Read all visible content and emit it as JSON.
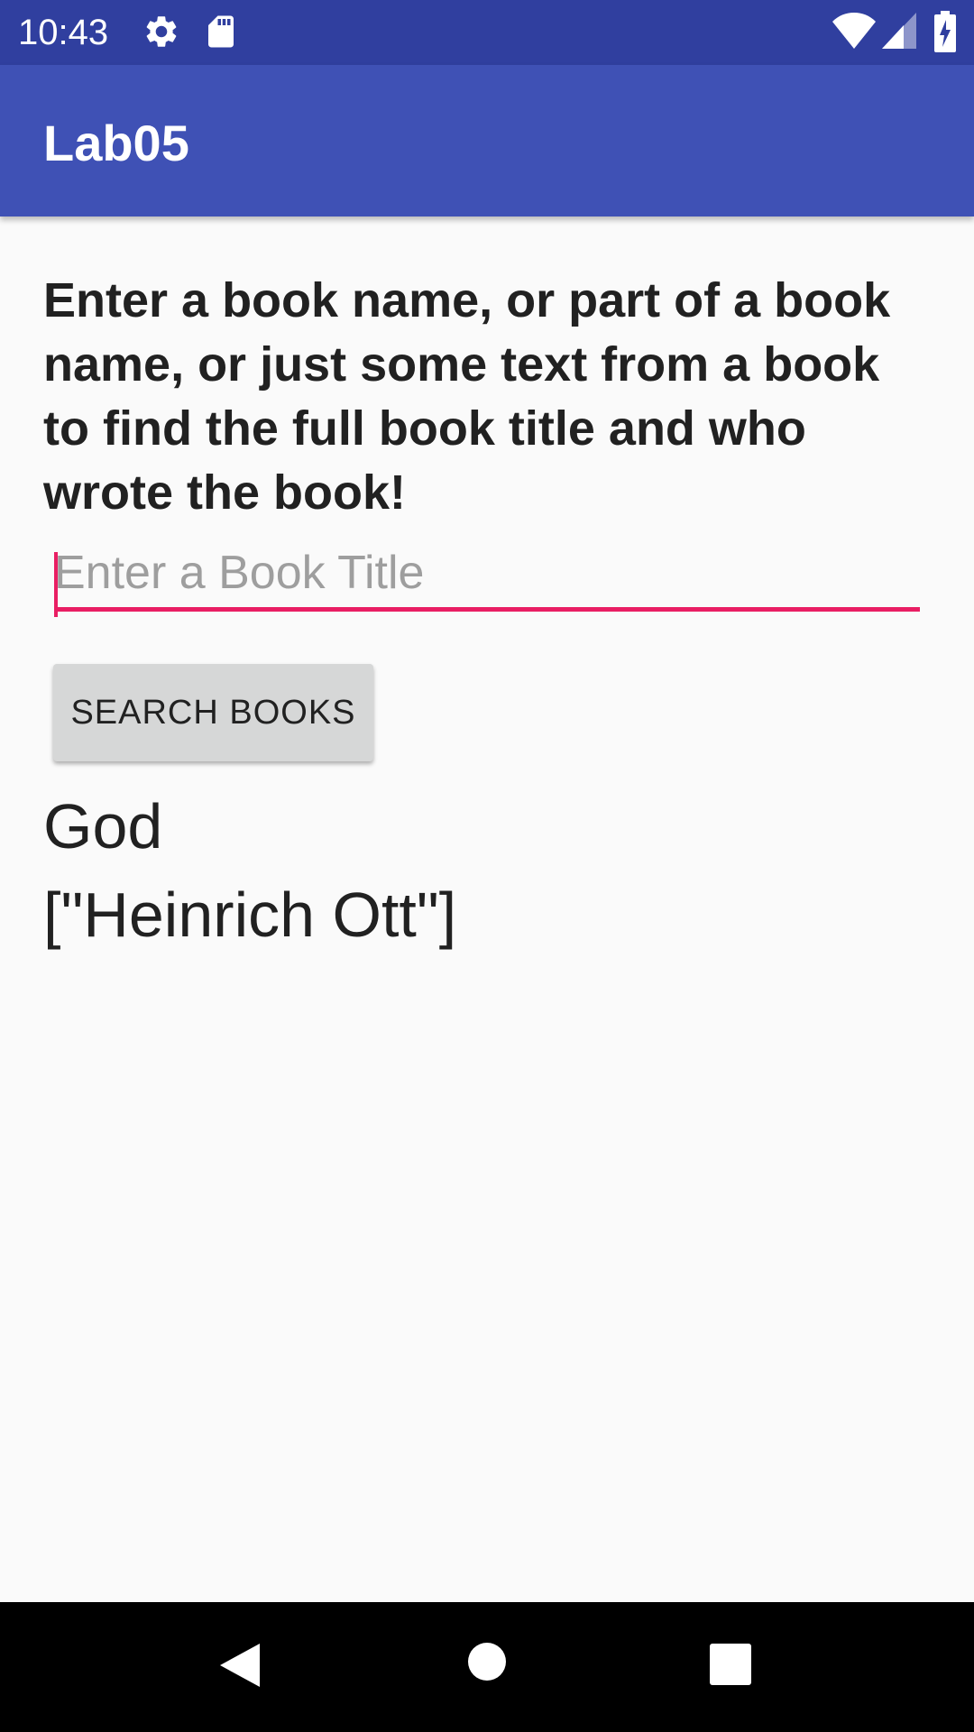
{
  "status_bar": {
    "time": "10:43",
    "icons": [
      "settings-icon",
      "sd-card-icon",
      "wifi-icon",
      "cell-signal-icon",
      "battery-charging-icon"
    ]
  },
  "app_bar": {
    "title": "Lab05"
  },
  "main": {
    "instructions": "Enter a book name, or part of a book name, or just some text from a book to find the full book title and who wrote the book!",
    "search": {
      "value": "",
      "placeholder": "Enter a Book Title"
    },
    "search_button_label": "SEARCH BOOKS",
    "result": {
      "title": "God",
      "authors": "[\"Heinrich Ott\"]"
    }
  },
  "nav_bar": {
    "buttons": [
      "back-icon",
      "home-icon",
      "recents-icon"
    ]
  },
  "colors": {
    "status_bar": "#303f9f",
    "app_bar": "#3f51b5",
    "accent": "#e91e63",
    "background": "#fafafa",
    "button": "#d6d7d7"
  }
}
